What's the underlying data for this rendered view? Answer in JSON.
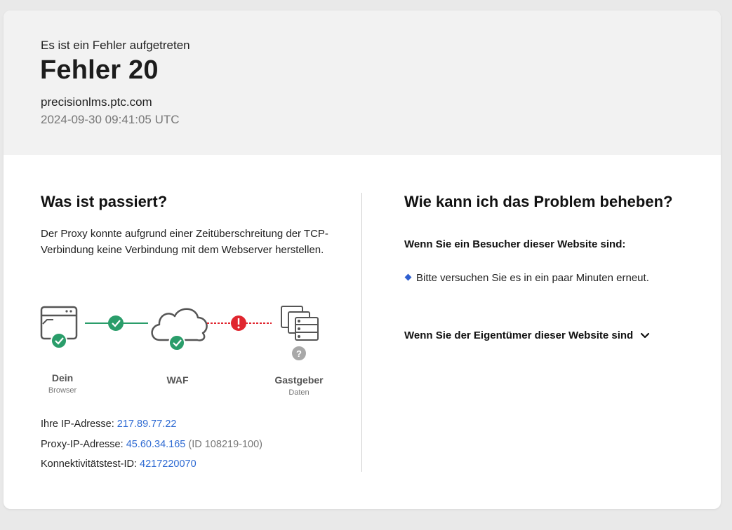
{
  "header": {
    "eyebrow": "Es ist ein Fehler aufgetreten",
    "title": "Fehler 20",
    "host": "precisionlms.ptc.com",
    "timestamp": "2024-09-30 09:41:05 UTC"
  },
  "left": {
    "heading": "Was ist passiert?",
    "explanation": "Der Proxy konnte aufgrund einer Zeitüberschreitung der TCP-Verbindung keine Verbindung mit dem Webserver herstellen.",
    "diagram": {
      "browser": {
        "label": "Dein",
        "sub": "Browser",
        "status": "ok"
      },
      "waf": {
        "label": "WAF",
        "status": "ok"
      },
      "host": {
        "label": "Gastgeber",
        "sub": "Daten",
        "status": "unknown"
      },
      "link1_status": "ok",
      "link2_status": "error",
      "colors": {
        "ok": "#2a9d6a",
        "error": "#e0262f",
        "unknown": "#a8a8a8"
      }
    },
    "info": {
      "ip_label": "Ihre IP-Adresse:",
      "ip_value": "217.89.77.22",
      "proxy_label": "Proxy-IP-Adresse:",
      "proxy_value": "45.60.34.165",
      "proxy_id": "(ID 108219-100)",
      "test_label": "Konnektivitätstest-ID:",
      "test_value": "4217220070"
    }
  },
  "right": {
    "heading": "Wie kann ich das Problem beheben?",
    "visitor_heading": "Wenn Sie ein Besucher dieser Website sind:",
    "visitor_tip": "Bitte versuchen Sie es in ein paar Minuten erneut.",
    "owner_heading": "Wenn Sie der Eigentümer dieser Website sind",
    "owner_icon": "chevron-down-icon"
  }
}
